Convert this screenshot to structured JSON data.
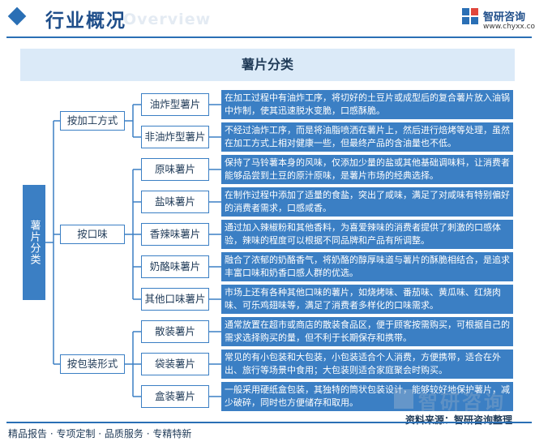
{
  "header": {
    "title": "行业概况",
    "watermark": "Overview",
    "logo": {
      "name": "智研咨询",
      "url": "www.chyxx.com"
    }
  },
  "diagram": {
    "title": "薯片分类",
    "root": "薯片分类",
    "categories": [
      {
        "label": "按加工方式",
        "items": [
          {
            "label": "油炸型薯片",
            "desc": "在加工过程中有油炸工序，将切好的土豆片或成型后的复合薯片放入油锅中炸制，使其迅速脱水变脆，口感酥脆。"
          },
          {
            "label": "非油炸型薯片",
            "desc": "不经过油炸工序，而是将油脂喷洒在薯片上，然后进行焙烤等处理，虽然在加工方式上相对健康一些，但最终产品的含油量也不低。"
          }
        ]
      },
      {
        "label": "按口味",
        "items": [
          {
            "label": "原味薯片",
            "desc": "保持了马铃薯本身的风味，仅添加少量的盐或其他基础调味料，让消费者能够品尝到土豆的原汁原味，是薯片市场的经典选择。"
          },
          {
            "label": "盐味薯片",
            "desc": "在制作过程中添加了适量的食盐，突出了咸味，满足了对咸味有特别偏好的消费者需求，口感咸香。"
          },
          {
            "label": "香辣味薯片",
            "desc": "通过加入辣椒粉和其他香料，为喜爱辣味的消费者提供了刺激的口感体验，辣味的程度可以根据不同品牌和产品有所调整。"
          },
          {
            "label": "奶酪味薯片",
            "desc": "融合了浓郁的奶酪香气，将奶酪的醇厚味道与薯片的酥脆相结合，是追求丰富口味和奶香口感人群的优选。"
          },
          {
            "label": "其他口味薯片",
            "desc": "市场上还有各种其他口味的薯片，如烧烤味、番茄味、黄瓜味、红烧肉味、可乐鸡翅味等，满足了消费者多样化的口味需求。"
          }
        ]
      },
      {
        "label": "按包装形式",
        "items": [
          {
            "label": "散装薯片",
            "desc": "通常放置在超市或商店的散装食品区，便于顾客按需购买，可根据自己的需求选择购买的量，但不利于长期保存和携带。"
          },
          {
            "label": "袋装薯片",
            "desc": "常见的有小包装和大包装，小包装适合个人消费，方便携带，适合在外出、旅行等场景中食用；大包装则适合家庭聚会时购买。"
          },
          {
            "label": "盒装薯片",
            "desc": "一般采用硬纸盒包装，其独特的筒状包装设计，能够较好地保护薯片，减少破碎，同时也方便储存和取用。"
          }
        ]
      }
    ]
  },
  "footer": {
    "tags": "精品报告 · 专项定制 · 品质服务 · 专精特新",
    "source": "资料来源：智研咨询整理",
    "logo_name": "智研咨询"
  },
  "colors": {
    "primary": "#3b7fc4",
    "band": "#dbeaf8",
    "header": "#2a6fb5"
  }
}
